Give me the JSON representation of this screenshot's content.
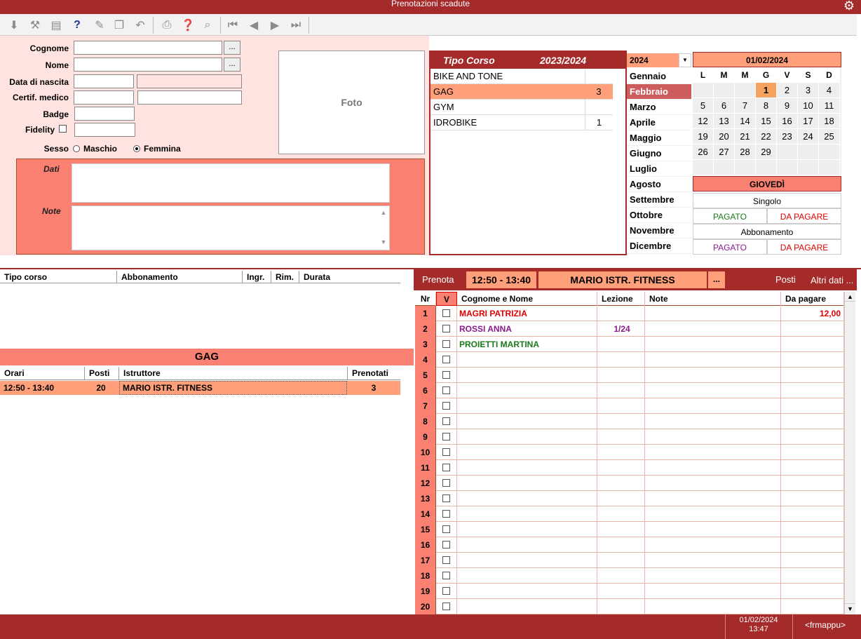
{
  "window": {
    "title": "Prenotazioni scadute"
  },
  "toolbar": {
    "icons": [
      "arrow-down-icon",
      "tools-icon",
      "notes-icon",
      "help-icon",
      "eraser-icon",
      "copy-icon",
      "undo-icon",
      "print-icon",
      "help-doc-icon",
      "preview-icon",
      "first-icon",
      "prev-icon",
      "next-icon",
      "last-icon"
    ]
  },
  "form": {
    "cognome_label": "Cognome",
    "nome_label": "Nome",
    "nascita_label": "Data di nascita",
    "certif_label": "Certif. medico",
    "badge_label": "Badge",
    "fidelity_label": "Fidelity",
    "sesso_label": "Sesso",
    "maschio_label": "Maschio",
    "femmina_label": "Femmina",
    "dots": "...",
    "foto_label": "Foto",
    "dati_label": "Dati",
    "note_label": "Note"
  },
  "tipo_corso": {
    "header": "Tipo Corso",
    "season": "2023/2024",
    "rows": [
      {
        "name": "BIKE AND TONE",
        "count": ""
      },
      {
        "name": "GAG",
        "count": "3"
      },
      {
        "name": "GYM",
        "count": ""
      },
      {
        "name": "IDROBIKE",
        "count": "1"
      }
    ]
  },
  "months": {
    "year": "2024",
    "list": [
      "Gennaio",
      "Febbraio",
      "Marzo",
      "Aprile",
      "Maggio",
      "Giugno",
      "Luglio",
      "Agosto",
      "Settembre",
      "Ottobre",
      "Novembre",
      "Dicembre"
    ],
    "selected": "Febbraio"
  },
  "calendar": {
    "date": "01/02/2024",
    "weekdays": [
      "L",
      "M",
      "M",
      "G",
      "V",
      "S",
      "D"
    ],
    "days": [
      "",
      "",
      "",
      "1",
      "2",
      "3",
      "4",
      "5",
      "6",
      "7",
      "8",
      "9",
      "10",
      "11",
      "12",
      "13",
      "14",
      "15",
      "16",
      "17",
      "18",
      "19",
      "20",
      "21",
      "22",
      "23",
      "24",
      "25",
      "26",
      "27",
      "28",
      "29",
      "",
      "",
      "",
      "",
      "",
      "",
      "",
      "",
      "",
      ""
    ],
    "today": "1",
    "dayname": "GIOVEDÌ",
    "singolo": "Singolo",
    "abbonamento": "Abbonamento",
    "pagato": "PAGATO",
    "da_pagare": "DA PAGARE"
  },
  "abbonamenti": {
    "columns": [
      "Tipo corso",
      "Abbonamento",
      "Ingr.",
      "Rim.",
      "Durata"
    ]
  },
  "orari": {
    "course": "GAG",
    "columns": [
      "Orari",
      "Posti",
      "Istruttore",
      "Prenotati"
    ],
    "row": {
      "orario": "12:50 - 13:40",
      "posti": "20",
      "istruttore": "MARIO ISTR. FITNESS",
      "prenotati": "3"
    }
  },
  "prenota": {
    "label": "Prenota",
    "time": "12:50 - 13:40",
    "instructor": "MARIO ISTR. FITNESS",
    "dots": "...",
    "posti": "Posti",
    "altri": "Altri dati ...",
    "columns": [
      "Nr",
      "V",
      "Cognome e Nome",
      "Lezione",
      "Note",
      "Da pagare"
    ],
    "rows": [
      {
        "nr": "1",
        "name": "MAGRI PATRIZIA",
        "lezione": "",
        "pagare": "12,00",
        "color": "#e00000"
      },
      {
        "nr": "2",
        "name": "ROSSI ANNA",
        "lezione": "1/24",
        "pagare": "",
        "color": "#8b1a8b"
      },
      {
        "nr": "3",
        "name": "PROIETTI MARTINA",
        "lezione": "",
        "pagare": "",
        "color": "#1a7a1a"
      },
      {
        "nr": "4"
      },
      {
        "nr": "5"
      },
      {
        "nr": "6"
      },
      {
        "nr": "7"
      },
      {
        "nr": "8"
      },
      {
        "nr": "9"
      },
      {
        "nr": "10"
      },
      {
        "nr": "11"
      },
      {
        "nr": "12"
      },
      {
        "nr": "13"
      },
      {
        "nr": "14"
      },
      {
        "nr": "15"
      },
      {
        "nr": "16"
      },
      {
        "nr": "17"
      },
      {
        "nr": "18"
      },
      {
        "nr": "19"
      },
      {
        "nr": "20"
      }
    ]
  },
  "status": {
    "date": "01/02/2024",
    "time": "13:47",
    "form": "<frmappu>"
  }
}
